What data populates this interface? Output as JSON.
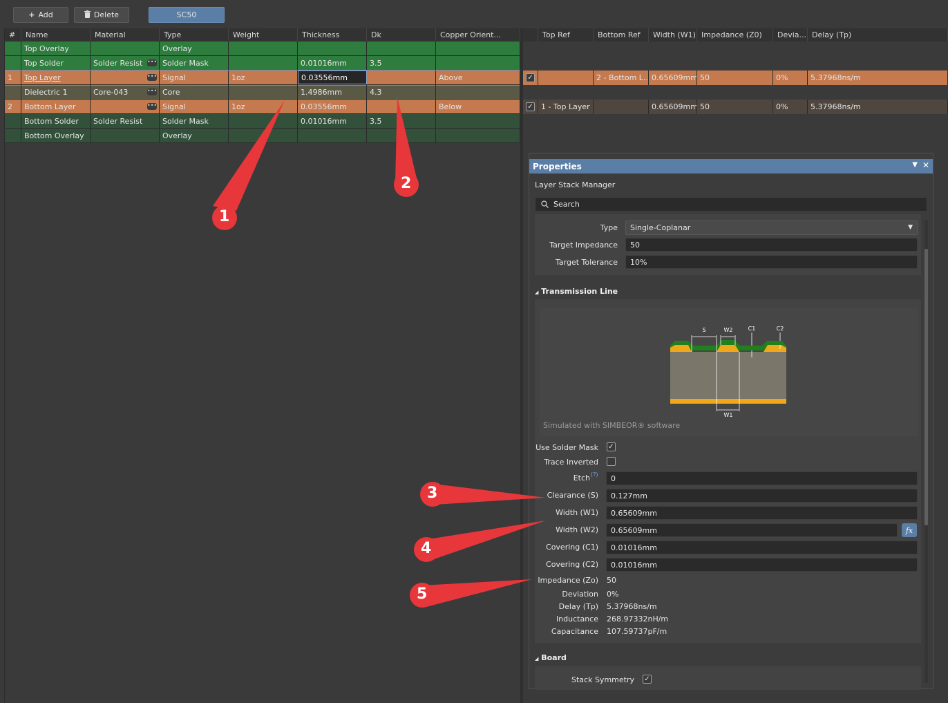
{
  "toolbar": {
    "add_label": "Add",
    "delete_label": "Delete",
    "stack_tab": "SC50"
  },
  "left_grid": {
    "columns": [
      "#",
      "Name",
      "Material",
      "Type",
      "Weight",
      "Thickness",
      "Dk",
      "Copper Orient..."
    ],
    "rows": [
      {
        "num": "",
        "name": "Top Overlay",
        "material": "",
        "type": "Overlay",
        "weight": "",
        "thickness": "",
        "dk": "",
        "orient": ""
      },
      {
        "num": "",
        "name": "Top Solder",
        "material": "Solder Resist",
        "type": "Solder Mask",
        "weight": "",
        "thickness": "0.01016mm",
        "dk": "3.5",
        "orient": ""
      },
      {
        "num": "1",
        "name": "Top Layer",
        "material": "",
        "type": "Signal",
        "weight": "1oz",
        "thickness": "0.03556mm",
        "dk": "",
        "orient": "Above"
      },
      {
        "num": "",
        "name": "Dielectric 1",
        "material": "Core-043",
        "type": "Core",
        "weight": "",
        "thickness": "1.4986mm",
        "dk": "4.3",
        "orient": ""
      },
      {
        "num": "2",
        "name": "Bottom Layer",
        "material": "",
        "type": "Signal",
        "weight": "1oz",
        "thickness": "0.03556mm",
        "dk": "",
        "orient": "Below"
      },
      {
        "num": "",
        "name": "Bottom Solder",
        "material": "Solder Resist",
        "type": "Solder Mask",
        "weight": "",
        "thickness": "0.01016mm",
        "dk": "3.5",
        "orient": ""
      },
      {
        "num": "",
        "name": "Bottom Overlay",
        "material": "",
        "type": "Overlay",
        "weight": "",
        "thickness": "",
        "dk": "",
        "orient": ""
      }
    ]
  },
  "right_grid": {
    "columns": [
      "",
      "Top Ref",
      "Bottom Ref",
      "Width (W1)",
      "Impedance (Z0)",
      "Devia...",
      "Delay (Tp)"
    ],
    "rows": [
      {
        "top_ref": "",
        "bottom_ref": "2 - Bottom L...",
        "width": "0.65609mm",
        "impedance": "50",
        "deviation": "0%",
        "delay": "5.37968ns/m"
      },
      {
        "top_ref": "1 - Top Layer",
        "bottom_ref": "",
        "width": "0.65609mm",
        "impedance": "50",
        "deviation": "0%",
        "delay": "5.37968ns/m"
      }
    ]
  },
  "properties": {
    "title": "Properties",
    "subtitle": "Layer Stack Manager",
    "search_placeholder": "Search",
    "type_label": "Type",
    "type_value": "Single-Coplanar",
    "target_impedance_label": "Target Impedance",
    "target_impedance_value": "50",
    "target_tolerance_label": "Target Tolerance",
    "target_tolerance_value": "10%",
    "transmission_section": "Transmission Line",
    "diagram_labels": {
      "s": "S",
      "w2": "W2",
      "c1": "C1",
      "c2": "C2",
      "w1": "W1"
    },
    "simulated_text": "Simulated with SIMBEOR® software",
    "use_solder_mask_label": "Use Solder Mask",
    "trace_inverted_label": "Trace Inverted",
    "etch_label": "Etch",
    "etch_value": "0",
    "clearance_label": "Clearance (S)",
    "clearance_value": "0.127mm",
    "width_w1_label": "Width (W1)",
    "width_w1_value": "0.65609mm",
    "width_w2_label": "Width (W2)",
    "width_w2_value": "0.65609mm",
    "fx_label": "fx",
    "covering_c1_label": "Covering (C1)",
    "covering_c1_value": "0.01016mm",
    "covering_c2_label": "Covering (C2)",
    "covering_c2_value": "0.01016mm",
    "impedance_label": "Impedance (Zo)",
    "impedance_value": "50",
    "deviation_label": "Deviation",
    "deviation_value": "0%",
    "delay_label": "Delay (Tp)",
    "delay_value": "5.37968ns/m",
    "inductance_label": "Inductance",
    "inductance_value": "268.97332nH/m",
    "capacitance_label": "Capacitance",
    "capacitance_value": "107.59737pF/m",
    "board_section": "Board",
    "stack_symmetry_label": "Stack Symmetry"
  },
  "callouts": [
    "1",
    "2",
    "3",
    "4",
    "5"
  ],
  "colors": {
    "green": "#2e7d3e",
    "dark_green": "#33513a",
    "orange": "#c47a4e",
    "accent_blue": "#5b7ea6",
    "callout_red": "#e8373b"
  }
}
